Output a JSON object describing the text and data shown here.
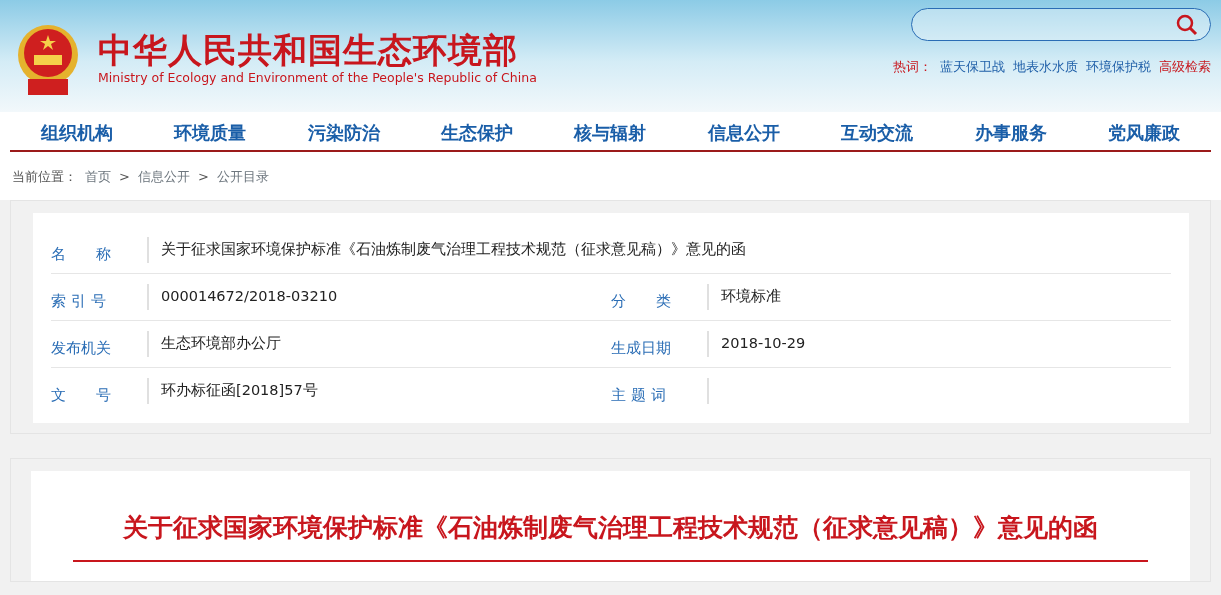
{
  "header": {
    "title": "中华人民共和国生态环境部",
    "subtitle": "Ministry of Ecology and Environment of the People's Republic of China",
    "hot_label": "热词：",
    "hot_words": [
      "蓝天保卫战",
      "地表水水质",
      "环境保护税"
    ],
    "advanced_search": "高级检索"
  },
  "nav": [
    "组织机构",
    "环境质量",
    "污染防治",
    "生态保护",
    "核与辐射",
    "信息公开",
    "互动交流",
    "办事服务",
    "党风廉政"
  ],
  "breadcrumb": {
    "label": "当前位置：",
    "items": [
      "首页",
      "信息公开",
      "公开目录"
    ],
    "separator": ">"
  },
  "info": [
    [
      {
        "label": "名　　称",
        "value": "关于征求国家环境保护标准《石油炼制废气治理工程技术规范（征求意见稿）》意见的函"
      }
    ],
    [
      {
        "label": "索 引 号",
        "value": "000014672/2018-03210"
      },
      {
        "label": "分　　类",
        "value": "环境标准"
      }
    ],
    [
      {
        "label": "发布机关",
        "value": "生态环境部办公厅"
      },
      {
        "label": "生成日期",
        "value": "2018-10-29"
      }
    ],
    [
      {
        "label": "文　　号",
        "value": "环办标征函[2018]57号"
      },
      {
        "label": "主 题 词"
      }
    ]
  ],
  "article": {
    "title": "关于征求国家环境保护标准《石油炼制废气治理工程技术规范（征求意见稿）》意见的函"
  }
}
